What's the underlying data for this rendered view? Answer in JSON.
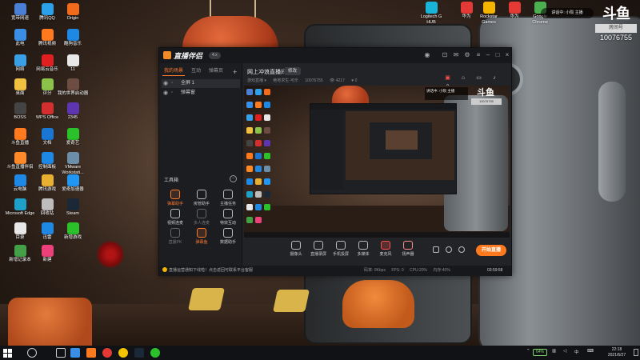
{
  "desktop": {
    "left_icons": [
      {
        "label": "宽带网速",
        "color": "#4a7fd6"
      },
      {
        "label": "腾讯QQ",
        "color": "#2aa1e8"
      },
      {
        "label": "Origin",
        "color": "#f26b1d"
      },
      {
        "label": "此电",
        "color": "#3a8ee6"
      },
      {
        "label": "腾讯视频",
        "color": "#ff7a1e"
      },
      {
        "label": "酷狗音乐",
        "color": "#1e88e5"
      },
      {
        "label": "网络",
        "color": "#3aa0e6"
      },
      {
        "label": "网易云音乐",
        "color": "#e02020"
      },
      {
        "label": "11",
        "color": "#e8e8e8"
      },
      {
        "label": "桌面",
        "color": "#f0c040"
      },
      {
        "label": "评分",
        "color": "#8bc34a"
      },
      {
        "label": "我的世界启动器",
        "color": "#6d4c41"
      },
      {
        "label": "BOSS",
        "color": "#444444"
      },
      {
        "label": "WPS Office",
        "color": "#d32f2f"
      },
      {
        "label": "2345",
        "color": "#5e35b1"
      },
      {
        "label": "斗鱼直播",
        "color": "#ff7a1e"
      },
      {
        "label": "文档",
        "color": "#1976d2"
      },
      {
        "label": "爱奇艺",
        "color": "#2bc12b"
      },
      {
        "label": "斗鱼直播伴侣",
        "color": "#ff8a2a"
      },
      {
        "label": "控制面板",
        "color": "#1e88e5"
      },
      {
        "label": "VMware Workstati...",
        "color": "#6d8ea8"
      },
      {
        "label": "云电脑",
        "color": "#1e88e5"
      },
      {
        "label": "腾讯游戏",
        "color": "#e8b030"
      },
      {
        "label": "爱奇加速器",
        "color": "#2196f3"
      },
      {
        "label": "Microsoft Edge",
        "color": "#1fa0c8"
      },
      {
        "label": "回收站",
        "color": "#bdbdbd"
      },
      {
        "label": "Steam",
        "color": "#1b2838"
      },
      {
        "label": "目录",
        "color": "#e8e8e8"
      },
      {
        "label": "迅雷",
        "color": "#1e88e5"
      },
      {
        "label": "新增游戏",
        "color": "#2bc12b"
      },
      {
        "label": "新增记录本",
        "color": "#43a047"
      },
      {
        "label": "新建",
        "color": "#ec407a"
      }
    ],
    "right_icons": [
      {
        "label": "Logitech G HUB",
        "color": "#19b5d9"
      },
      {
        "label": "华为",
        "color": "#e53935"
      },
      {
        "label": "Rockstar Games",
        "color": "#f5b400"
      },
      {
        "label": "华为",
        "color": "#e53935"
      },
      {
        "label": "Google Chrome",
        "color": "#4caf50"
      }
    ]
  },
  "overlay": {
    "badge_text": "讲话中: 小陨 主播",
    "logo": "斗鱼",
    "room_tag": "房间号",
    "room_number": "10076755"
  },
  "app": {
    "name": "直播伴侣",
    "version": "4.x",
    "sidebar": {
      "tabs": [
        "我的场景",
        "互动",
        "弹幕页"
      ],
      "scenes": [
        {
          "label": "全屏 1"
        },
        {
          "label": "弹幕窗"
        }
      ],
      "tools_title": "工具箱",
      "tools": [
        {
          "label": "弹幕助手",
          "state": "hot"
        },
        {
          "label": "房管助手",
          "state": "normal"
        },
        {
          "label": "主播任务",
          "state": "normal"
        },
        {
          "label": "视频连麦",
          "state": "normal"
        },
        {
          "label": "多人连麦",
          "state": "dim"
        },
        {
          "label": "特效互动",
          "state": "normal"
        },
        {
          "label": "直播PK",
          "state": "dim"
        },
        {
          "label": "弹幕鱼",
          "state": "hot"
        },
        {
          "label": "数据助手",
          "state": "normal"
        }
      ]
    },
    "main": {
      "stream_title": "网上冲浪直播间",
      "edit_label": "修改",
      "info": [
        "游戏直播 ▾",
        "绝地求生·可乐",
        "10076755",
        "👁 4217",
        "♥ 0"
      ],
      "controls": [
        {
          "label": "摄像头",
          "icon": "camera-icon"
        },
        {
          "label": "直播录屏",
          "icon": "screen-icon"
        },
        {
          "label": "手机投屏",
          "icon": "phone-icon"
        },
        {
          "label": "多媒体",
          "icon": "media-icon"
        },
        {
          "label": "麦克风",
          "icon": "mic-icon"
        },
        {
          "label": "扬声器",
          "icon": "speaker-icon"
        }
      ],
      "go_live": "开始直播"
    },
    "status": {
      "note": "直播运营通知下线啦！点击返回可联系平台客服",
      "stats": [
        "码率: 0Kbps",
        "FPS: 0",
        "CPU:20%",
        "内存:40%"
      ],
      "timer": "03:59:58"
    }
  },
  "taskbar": {
    "battery": "64%",
    "time": "22:18",
    "date": "2021/6/27"
  }
}
